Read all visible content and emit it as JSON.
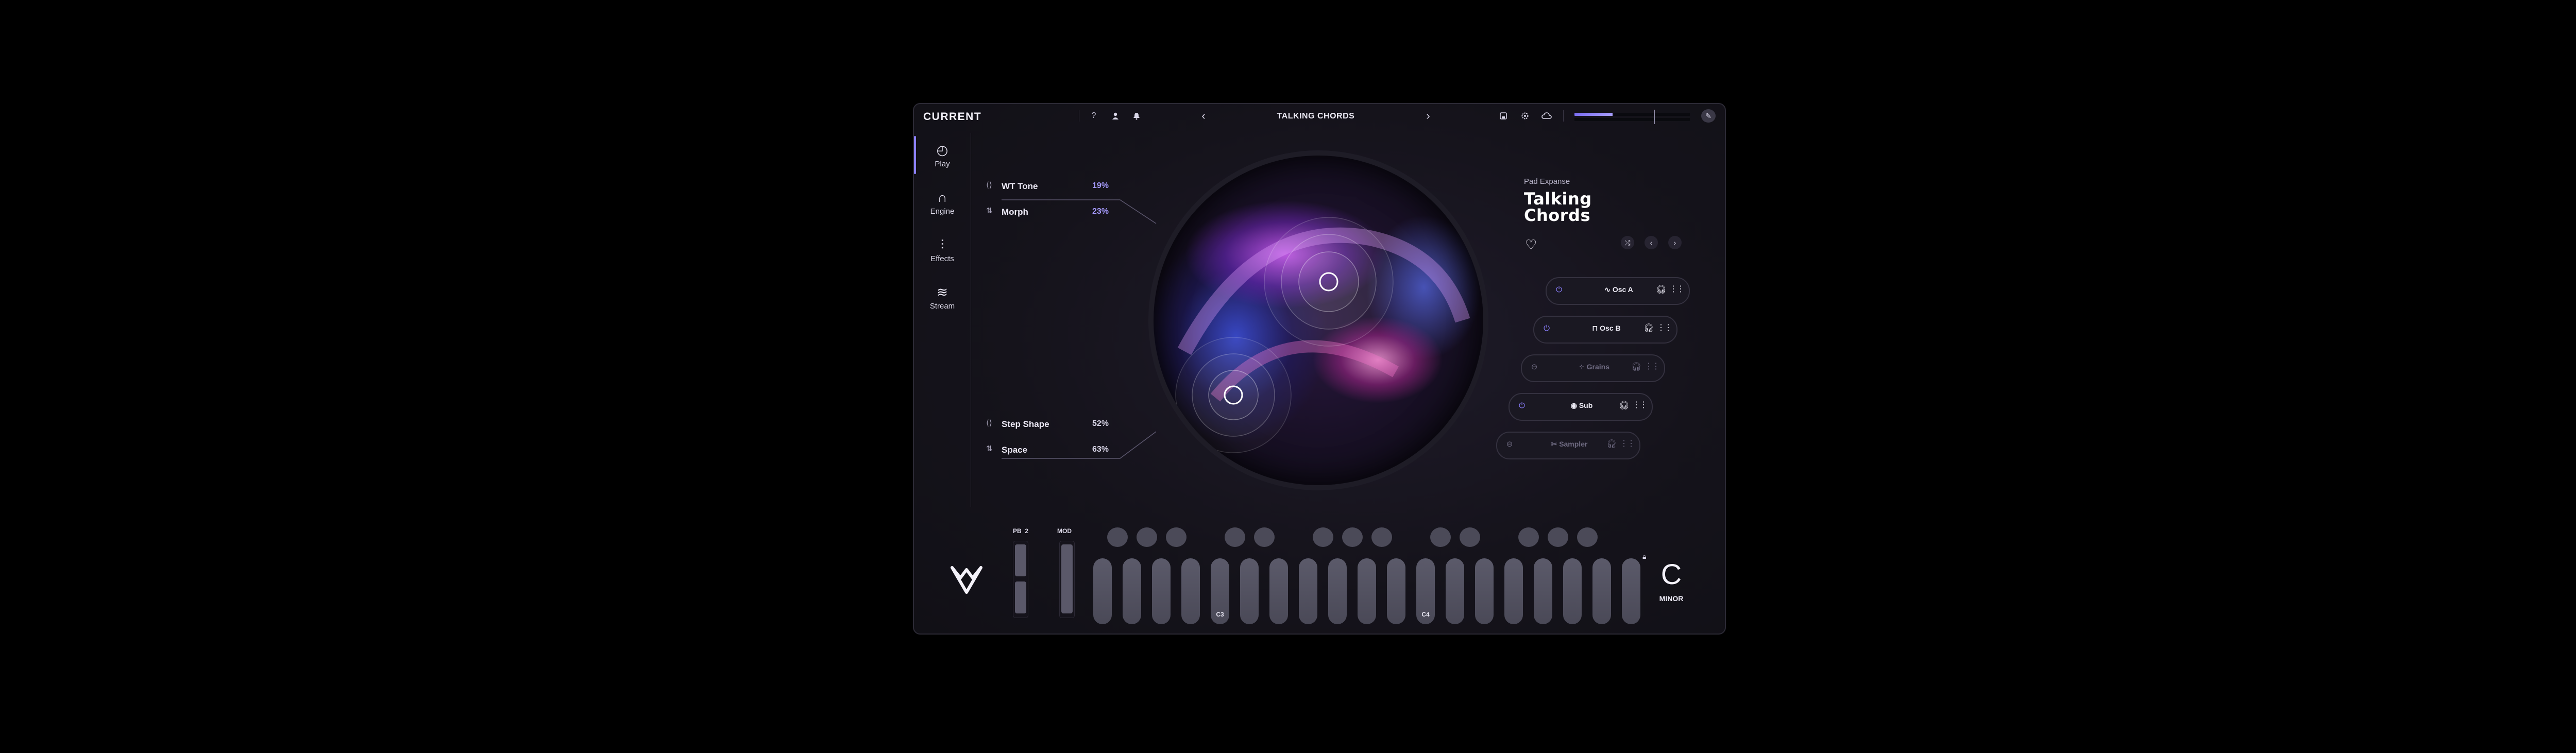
{
  "app": {
    "logo": "CURRENT"
  },
  "topbar": {
    "icons": [
      "help-icon",
      "user-icon",
      "bell-icon",
      "save-icon",
      "settings-icon",
      "cloud-icon",
      "edit-icon"
    ],
    "preset_title": "TALKING CHORDS",
    "prev_arrow": "‹",
    "next_arrow": "›",
    "meter": {
      "left_level": 0.33,
      "right_level": 0.0
    }
  },
  "sidebar": {
    "items": [
      {
        "label": "Play",
        "icon": "play-dial-icon",
        "glyph": "◴"
      },
      {
        "label": "Engine",
        "icon": "waveform-icon",
        "glyph": "∩"
      },
      {
        "label": "Effects",
        "icon": "sliders-icon",
        "glyph": "⫶"
      },
      {
        "label": "Stream",
        "icon": "stream-icon",
        "glyph": "≋"
      }
    ]
  },
  "macros": [
    {
      "name": "WT Tone",
      "value": "19%",
      "icon": "bracket-icon",
      "glyph": "⟨⟩",
      "accent": "#a79cff"
    },
    {
      "name": "Morph",
      "value": "23%",
      "icon": "arrows-icon",
      "glyph": "⇅",
      "accent": "#a79cff"
    },
    {
      "name": "Step Shape",
      "value": "52%",
      "icon": "bracket-icon",
      "glyph": "⟨⟩",
      "accent": "#d9d6e8"
    },
    {
      "name": "Space",
      "value": "63%",
      "icon": "arrows-icon",
      "glyph": "⇅",
      "accent": "#d9d6e8"
    }
  ],
  "preset": {
    "pack": "Pad Expanse",
    "name_line1": "Talking",
    "name_line2": "Chords"
  },
  "layers": [
    {
      "name": "Osc A",
      "on": true,
      "icon": "sine-icon",
      "glyph": "∿"
    },
    {
      "name": "Osc B",
      "on": true,
      "icon": "square-wave-icon",
      "glyph": "⊓"
    },
    {
      "name": "Grains",
      "on": false,
      "icon": "grains-icon",
      "glyph": "⁘"
    },
    {
      "name": "Sub",
      "on": true,
      "icon": "sub-icon",
      "glyph": "◉"
    },
    {
      "name": "Sampler",
      "on": false,
      "icon": "sampler-icon",
      "glyph": "✂"
    }
  ],
  "keyboard": {
    "pb_label": "PB",
    "pb_range": "2",
    "mod_label": "MOD",
    "labels": {
      "c3": "C3",
      "c4": "C4"
    },
    "key_note": "C",
    "scale_mode": "MINOR"
  }
}
